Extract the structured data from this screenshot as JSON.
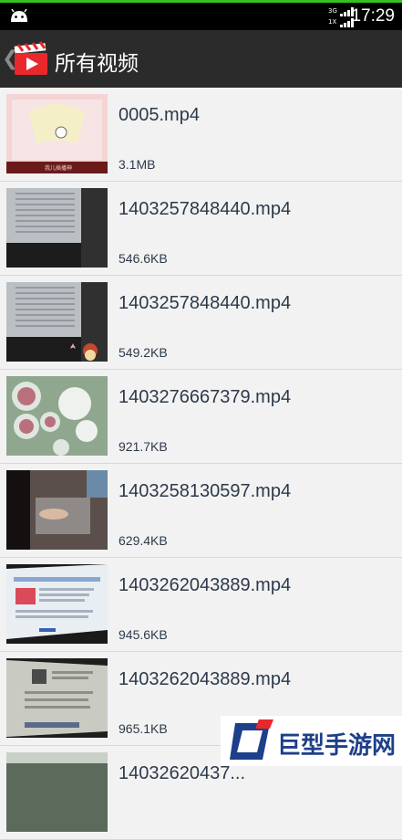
{
  "status_bar": {
    "time": "17:29",
    "network_label_top": "3G",
    "network_label_bottom": "1X",
    "icons": [
      "android-icon",
      "signal-3g-icon",
      "signal-1x-icon"
    ]
  },
  "app_bar": {
    "title": "所有视频",
    "icons": [
      "back-chevron-icon",
      "clapperboard-play-icon"
    ]
  },
  "videos": [
    {
      "name": "0005.mp4",
      "size": "3.1MB",
      "thumb_caption": "我儿插播神"
    },
    {
      "name": "1403257848440.mp4",
      "size": "546.6KB"
    },
    {
      "name": "1403257848440.mp4",
      "size": "549.2KB"
    },
    {
      "name": "1403276667379.mp4",
      "size": "921.7KB"
    },
    {
      "name": "1403258130597.mp4",
      "size": "629.4KB"
    },
    {
      "name": "1403262043889.mp4",
      "size": "945.6KB"
    },
    {
      "name": "1403262043889.mp4",
      "size": "965.1KB"
    },
    {
      "name": "14032620437...",
      "size": ""
    }
  ],
  "watermark": {
    "text": "巨型手游网"
  },
  "colors": {
    "status_accent": "#34c21e",
    "appbar": "#2b2b2b",
    "list_bg": "#f2f2f2",
    "text": "#2d3a4a",
    "icon_red": "#e8282c"
  }
}
